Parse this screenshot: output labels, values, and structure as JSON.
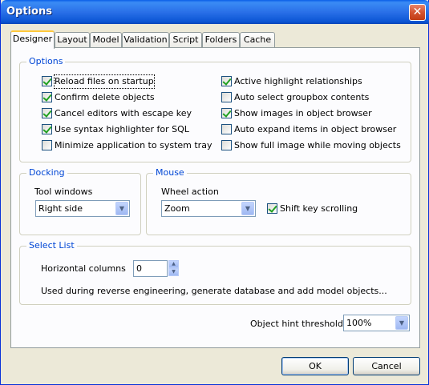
{
  "window": {
    "title": "Options",
    "close_label": "✕"
  },
  "tabs": [
    {
      "label": "Designer",
      "active": true
    },
    {
      "label": "Layout"
    },
    {
      "label": "Model"
    },
    {
      "label": "Validation"
    },
    {
      "label": "Script"
    },
    {
      "label": "Folders"
    },
    {
      "label": "Cache"
    }
  ],
  "options_group": {
    "title": "Options",
    "left": [
      {
        "label": "Reload files on startup",
        "checked": true
      },
      {
        "label": "Confirm delete objects",
        "checked": true
      },
      {
        "label": "Cancel editors with escape key",
        "checked": true
      },
      {
        "label": "Use syntax highlighter for SQL",
        "checked": true
      },
      {
        "label": "Minimize application to system tray",
        "checked": false
      }
    ],
    "right": [
      {
        "label": "Active highlight relationships",
        "checked": true
      },
      {
        "label": "Auto select groupbox contents",
        "checked": false
      },
      {
        "label": "Show images in object browser",
        "checked": true
      },
      {
        "label": "Auto expand items in object browser",
        "checked": false
      },
      {
        "label": "Show full image while moving objects",
        "checked": false
      }
    ]
  },
  "docking": {
    "title": "Docking",
    "tool_windows_label": "Tool windows",
    "tool_windows_value": "Right side"
  },
  "mouse": {
    "title": "Mouse",
    "wheel_action_label": "Wheel action",
    "wheel_action_value": "Zoom",
    "shift_scroll_label": "Shift key scrolling",
    "shift_scroll_checked": true
  },
  "select_list": {
    "title": "Select List",
    "horizontal_columns_label": "Horizontal columns",
    "horizontal_columns_value": "0",
    "description": "Used  during reverse engineering, generate database and add model objects..."
  },
  "object_hint": {
    "label": "Object hint threshold",
    "value": "100%"
  },
  "buttons": {
    "ok": "OK",
    "cancel": "Cancel"
  },
  "icons": {
    "dropdown": "▼",
    "spin_up": "▲",
    "spin_down": "▼"
  }
}
